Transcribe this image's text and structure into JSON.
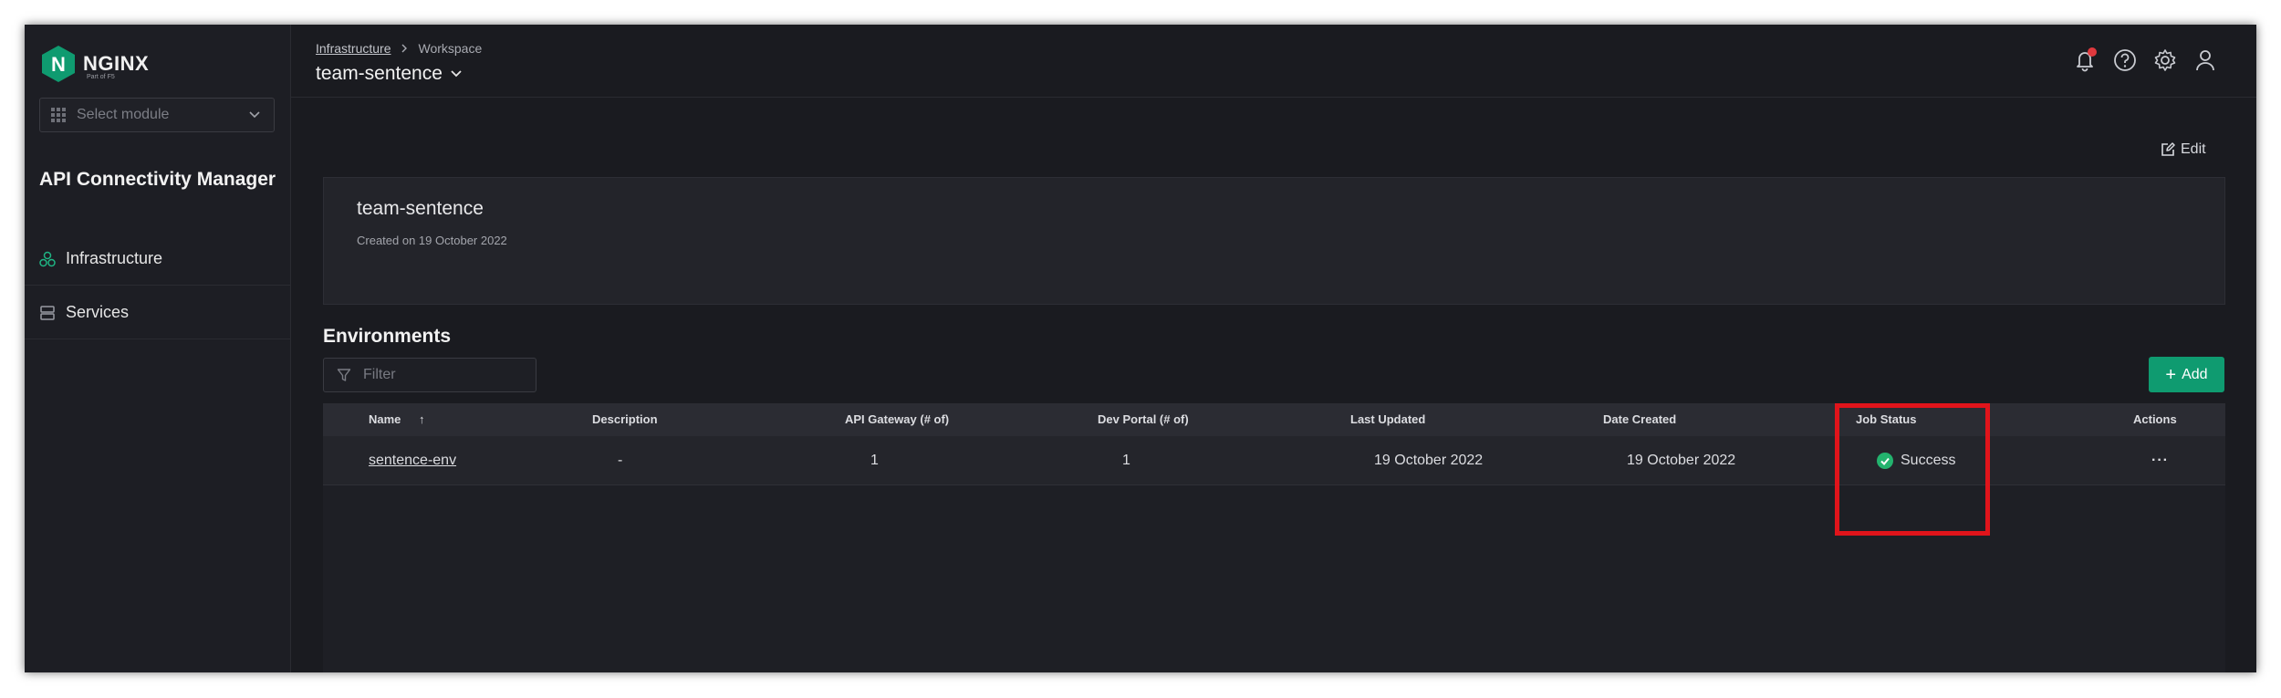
{
  "brand": {
    "name": "NGINX",
    "subtitle": "Part of F5",
    "color": "#0f9b70"
  },
  "sidebar": {
    "module_select": {
      "placeholder": "Select module"
    },
    "app_title": "API Connectivity Manager",
    "items": [
      {
        "label": "Infrastructure",
        "icon": "infrastructure-icon"
      },
      {
        "label": "Services",
        "icon": "services-icon"
      }
    ]
  },
  "header": {
    "breadcrumb": {
      "parent": "Infrastructure",
      "current": "Workspace"
    },
    "workspace_title": "team-sentence",
    "icons": [
      "bell-icon",
      "help-icon",
      "gear-icon",
      "user-icon"
    ]
  },
  "workspace": {
    "edit_label": "Edit",
    "name": "team-sentence",
    "created": "Created on 19 October 2022"
  },
  "environments": {
    "title": "Environments",
    "filter_placeholder": "Filter",
    "add_label": "Add",
    "columns": [
      "Name",
      "Description",
      "API Gateway (# of)",
      "Dev Portal (# of)",
      "Last Updated",
      "Date Created",
      "Job Status",
      "Actions"
    ],
    "sort_indicator": "↑",
    "rows": [
      {
        "name": "sentence-env",
        "description": "-",
        "api_gateway": "1",
        "dev_portal": "1",
        "last_updated": "19 October 2022",
        "date_created": "19 October 2022",
        "job_status": "Success",
        "actions": "···"
      }
    ]
  },
  "colors": {
    "success": "#23b36e",
    "highlight": "#e0141b",
    "accent": "#0f9b70"
  }
}
